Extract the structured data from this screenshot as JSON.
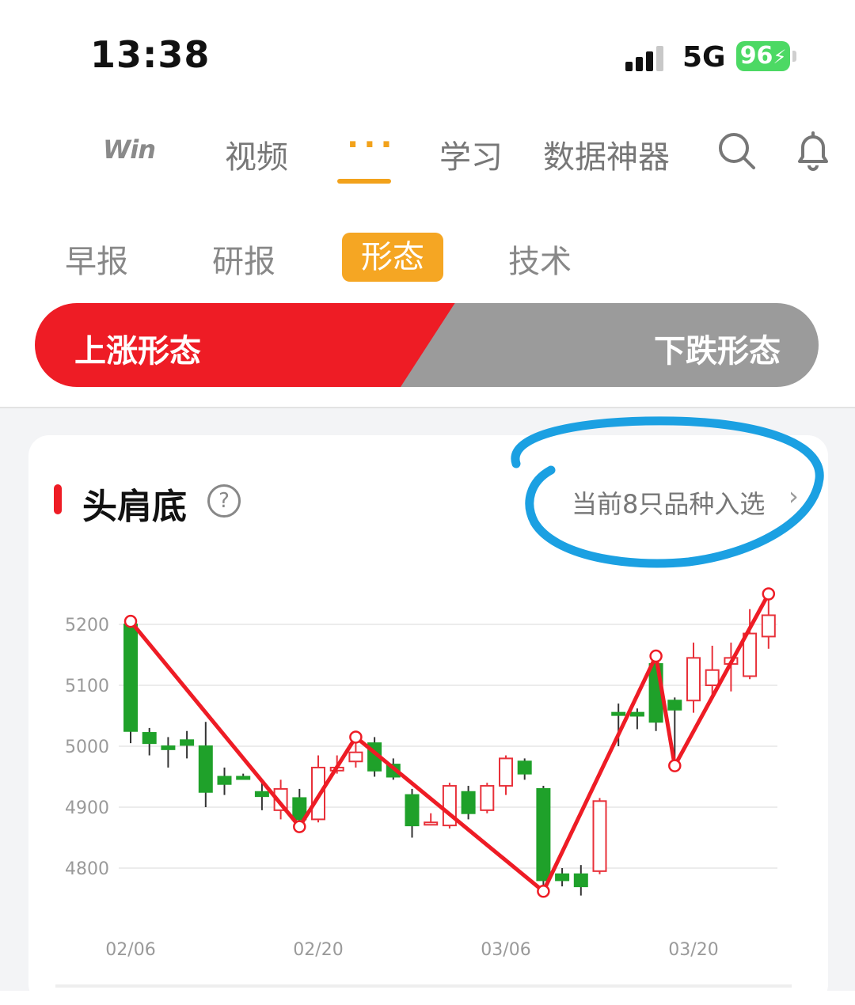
{
  "status_bar": {
    "time": "13:38",
    "network": "5G",
    "battery": "96"
  },
  "top_nav": {
    "logo": "Win",
    "items": [
      "视频",
      "学习",
      "数据神器"
    ],
    "active_dots": "...",
    "accent_color": "#f2a21b"
  },
  "sub_tabs": {
    "items": [
      "早报",
      "研报",
      "技术"
    ],
    "active": "形态"
  },
  "segment": {
    "up_label": "上涨形态",
    "down_label": "下跌形态",
    "up_color": "#ee1c25",
    "down_color": "#9b9b9b"
  },
  "card": {
    "title": "头肩底",
    "help_glyph": "?",
    "count_text": "当前8只品种入选",
    "chevron": "›"
  },
  "chart_data": {
    "type": "candlestick",
    "ylim": [
      4750,
      5260
    ],
    "yticks": [
      4800,
      4900,
      5000,
      5100,
      5200
    ],
    "xticks": [
      {
        "label": "02/06",
        "index": 0
      },
      {
        "label": "02/20",
        "index": 10
      },
      {
        "label": "03/06",
        "index": 20
      },
      {
        "label": "03/20",
        "index": 30
      }
    ],
    "up_color": "#e8313a",
    "down_color": "#1fa12a",
    "pattern_color": "#ee1c25",
    "candles": [
      {
        "o": 5200,
        "c": 5025,
        "h": 5205,
        "l": 5005
      },
      {
        "o": 5022,
        "c": 5005,
        "h": 5030,
        "l": 4985
      },
      {
        "o": 5000,
        "c": 4995,
        "h": 5015,
        "l": 4965
      },
      {
        "o": 5010,
        "c": 5002,
        "h": 5025,
        "l": 4980
      },
      {
        "o": 5000,
        "c": 4925,
        "h": 5040,
        "l": 4900
      },
      {
        "o": 4950,
        "c": 4938,
        "h": 4965,
        "l": 4920
      },
      {
        "o": 4950,
        "c": 4948,
        "h": 4955,
        "l": 4945
      },
      {
        "o": 4925,
        "c": 4918,
        "h": 4945,
        "l": 4895
      },
      {
        "o": 4895,
        "c": 4930,
        "h": 4945,
        "l": 4880
      },
      {
        "o": 4915,
        "c": 4880,
        "h": 4930,
        "l": 4870
      },
      {
        "o": 4880,
        "c": 4965,
        "h": 4985,
        "l": 4875
      },
      {
        "o": 4960,
        "c": 4965,
        "h": 4985,
        "l": 4955
      },
      {
        "o": 4975,
        "c": 4990,
        "h": 5010,
        "l": 4965
      },
      {
        "o": 5005,
        "c": 4960,
        "h": 5015,
        "l": 4950
      },
      {
        "o": 4970,
        "c": 4950,
        "h": 4980,
        "l": 4945
      },
      {
        "o": 4920,
        "c": 4870,
        "h": 4930,
        "l": 4850
      },
      {
        "o": 4875,
        "c": 4875,
        "h": 4890,
        "l": 4870
      },
      {
        "o": 4870,
        "c": 4935,
        "h": 4940,
        "l": 4865
      },
      {
        "o": 4925,
        "c": 4890,
        "h": 4935,
        "l": 4880
      },
      {
        "o": 4895,
        "c": 4935,
        "h": 4940,
        "l": 4890
      },
      {
        "o": 4935,
        "c": 4980,
        "h": 4985,
        "l": 4920
      },
      {
        "o": 4975,
        "c": 4955,
        "h": 4980,
        "l": 4945
      },
      {
        "o": 4930,
        "c": 4780,
        "h": 4935,
        "l": 4765
      },
      {
        "o": 4790,
        "c": 4780,
        "h": 4800,
        "l": 4770
      },
      {
        "o": 4790,
        "c": 4770,
        "h": 4805,
        "l": 4755
      },
      {
        "o": 4795,
        "c": 4910,
        "h": 4915,
        "l": 4790
      },
      {
        "o": 5055,
        "c": 5052,
        "h": 5070,
        "l": 5000
      },
      {
        "o": 5055,
        "c": 5050,
        "h": 5062,
        "l": 5028
      },
      {
        "o": 5135,
        "c": 5040,
        "h": 5140,
        "l": 5025
      },
      {
        "o": 5075,
        "c": 5060,
        "h": 5080,
        "l": 4970
      },
      {
        "o": 5075,
        "c": 5145,
        "h": 5170,
        "l": 5055
      },
      {
        "o": 5100,
        "c": 5125,
        "h": 5165,
        "l": 5080
      },
      {
        "o": 5135,
        "c": 5145,
        "h": 5170,
        "l": 5090
      },
      {
        "o": 5115,
        "c": 5185,
        "h": 5225,
        "l": 5110
      },
      {
        "o": 5180,
        "c": 5215,
        "h": 5240,
        "l": 5160
      }
    ],
    "pattern_line": [
      {
        "index": 0,
        "value": 5205
      },
      {
        "index": 9,
        "value": 4868
      },
      {
        "index": 12,
        "value": 5015
      },
      {
        "index": 22,
        "value": 4762
      },
      {
        "index": 28,
        "value": 5148
      },
      {
        "index": 29,
        "value": 4968
      },
      {
        "index": 34,
        "value": 5250
      }
    ]
  }
}
